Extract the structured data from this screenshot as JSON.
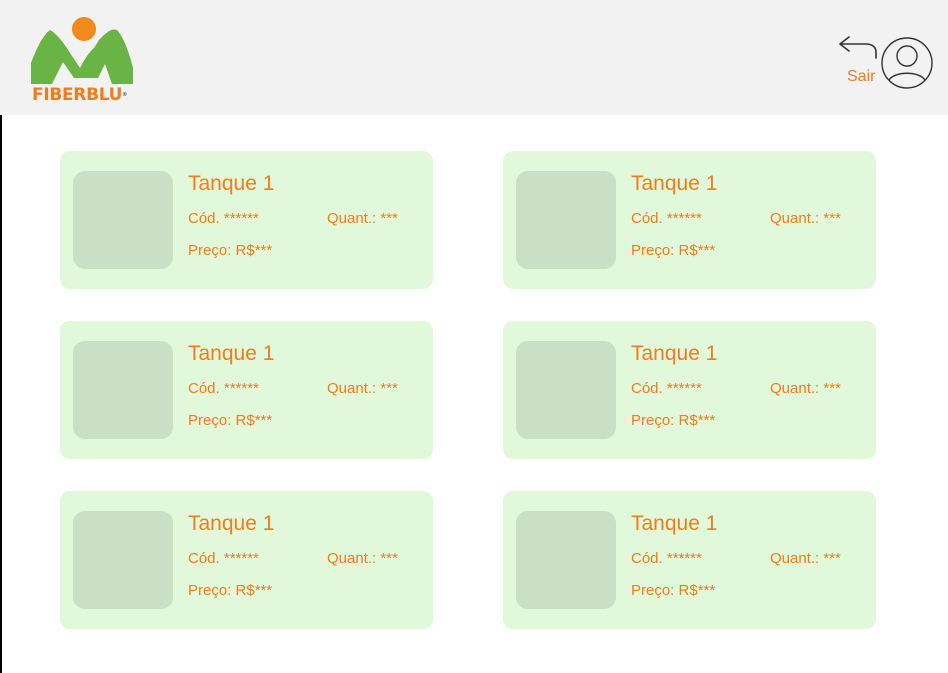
{
  "colors": {
    "accent": "#f07c1b",
    "logo_green": "#6ab445",
    "logo_orange": "#f08a1f",
    "header_bg": "#f2f2f2",
    "card_bg": "#e1f8da",
    "thumb_bg": "#cbdec6"
  },
  "header": {
    "logo": {
      "text": "FIBERBLU",
      "registered_mark": "®"
    },
    "logout": {
      "icon": "return-arrow-icon",
      "label": "Sair"
    },
    "avatar_icon": "user-circle-icon"
  },
  "products": [
    {
      "title": "Tanque 1",
      "code": "Cód. ******",
      "quantity": "Quant.: ***",
      "price": "Preço: R$***"
    },
    {
      "title": "Tanque 1",
      "code": "Cód. ******",
      "quantity": "Quant.: ***",
      "price": "Preço: R$***"
    },
    {
      "title": "Tanque 1",
      "code": "Cód. ******",
      "quantity": "Quant.: ***",
      "price": "Preço: R$***"
    },
    {
      "title": "Tanque 1",
      "code": "Cód. ******",
      "quantity": "Quant.: ***",
      "price": "Preço: R$***"
    },
    {
      "title": "Tanque 1",
      "code": "Cód. ******",
      "quantity": "Quant.: ***",
      "price": "Preço: R$***"
    },
    {
      "title": "Tanque 1",
      "code": "Cód. ******",
      "quantity": "Quant.: ***",
      "price": "Preço: R$***"
    }
  ]
}
